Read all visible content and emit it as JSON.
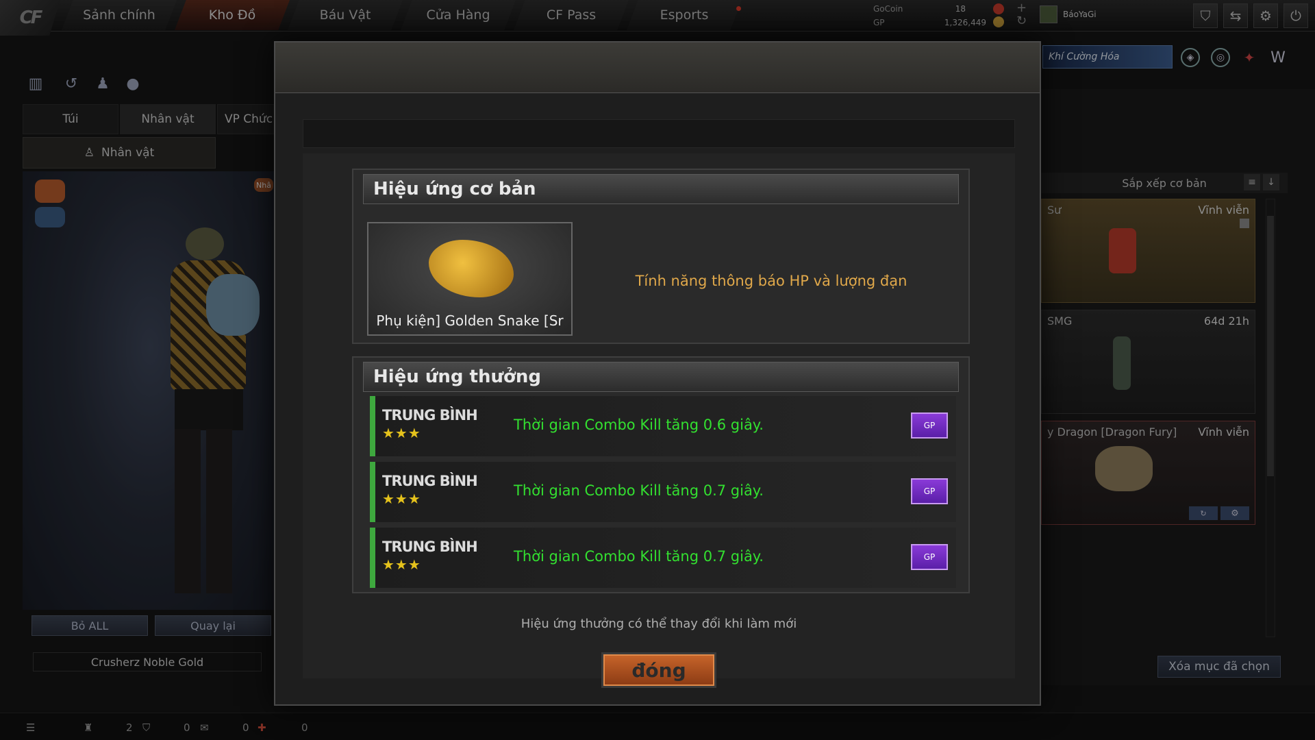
{
  "topbar": {
    "logo_text": "CF",
    "tabs": [
      {
        "label": "Sảnh chính"
      },
      {
        "label": "Kho Đồ"
      },
      {
        "label": "Báu Vật"
      },
      {
        "label": "Cửa Hàng"
      },
      {
        "label": "CF Pass"
      },
      {
        "label": "Esports"
      }
    ],
    "active_tab": "Kho Đồ",
    "currency": [
      {
        "label": "GoCoin",
        "value": "18"
      },
      {
        "label": "GP",
        "value": "1,326,449"
      }
    ],
    "username": "BáoYaGi"
  },
  "left_panel": {
    "tabs": [
      {
        "label": "Túi"
      },
      {
        "label": "Nhân vật"
      },
      {
        "label": "VP Chức"
      }
    ],
    "sub_button": "Nhân vật",
    "badge_short": "Nhâ",
    "buttons": {
      "clear_all": "Bỏ ALL",
      "back": "Quay lại"
    },
    "character_name": "Crusherz Noble Gold"
  },
  "right_panel": {
    "promo_text": "Khí Cường Hóa",
    "sort_label": "Sắp xếp cơ bản",
    "cards": [
      {
        "name": "Sư",
        "time": "Vĩnh viễn"
      },
      {
        "name": "SMG",
        "time": "64d 21h"
      },
      {
        "name": "y Dragon [Dragon Fury]",
        "time": "Vĩnh viễn"
      }
    ],
    "clear_selected": "Xóa mục đã chọn"
  },
  "statusbar": {
    "counts": [
      "2",
      "0",
      "0",
      "0"
    ]
  },
  "modal": {
    "basic_section_title": "Hiệu ứng cơ bản",
    "item_name": "Phụ kiện] Golden Snake [Sr",
    "basic_effect": "Tính năng thông báo HP và lượng đạn",
    "bonus_section_title": "Hiệu ứng thưởng",
    "rows": [
      {
        "tier": "TRUNG BÌNH",
        "stars": "★★★",
        "text": "Thời gian Combo Kill tăng 0.6 giây.",
        "button_label": "GP"
      },
      {
        "tier": "TRUNG BÌNH",
        "stars": "★★★",
        "text": "Thời gian Combo Kill tăng 0.7 giây.",
        "button_label": "GP"
      },
      {
        "tier": "TRUNG BÌNH",
        "stars": "★★★",
        "text": "Thời gian Combo Kill tăng 0.7 giây.",
        "button_label": "GP"
      }
    ],
    "note": "Hiệu ứng thưởng có thể thay đổi khi làm mới",
    "close_label": "đóng"
  },
  "colors": {
    "accent_orange": "#e0a84a",
    "effect_green": "#33e030",
    "refresh_purple": "#6a28c0",
    "close_orange": "#c8652a"
  }
}
